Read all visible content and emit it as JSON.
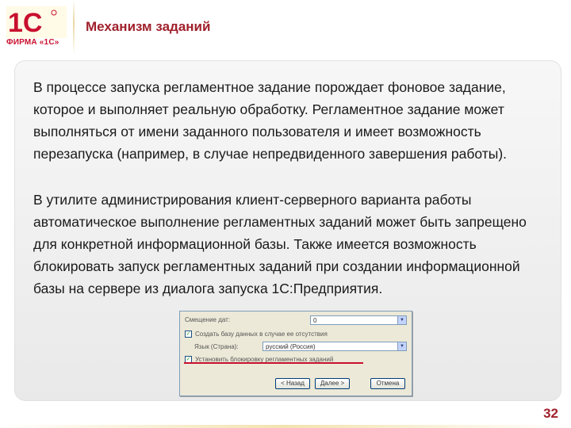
{
  "logo": {
    "mark": "1С",
    "caption": "ФИРМА «1С»"
  },
  "title": "Механизм заданий",
  "paragraphs": [
    "В процессе запуска регламентное задание порождает фоновое задание, которое и выполняет реальную обработку. Регламентное задание может выполняться от имени заданного пользователя и имеет возможность перезапуска (например, в случае непредвиденного завершения работы).",
    "В утилите администрирования клиент-серверного варианта работы автоматическое выполнение регламентных заданий может быть запрещено для конкретной информационной базы. Также имеется возможность блокировать запуск регламентных заданий при создании информационной базы на сервере из диалога запуска 1С:Предприятия."
  ],
  "dialog": {
    "offset_label": "Смещение дат:",
    "offset_value": "0",
    "create_db_label": "Создать базу данных в случае ее отсутствия",
    "language_label": "Язык (Страна):",
    "language_value": "русский (Россия)",
    "block_label": "Установить блокировку регламентных заданий",
    "buttons": [
      "< Назад",
      "Далее >",
      "Отмена"
    ]
  },
  "page_number": "32",
  "colors": {
    "accent": "#a0212c",
    "brand_red": "#c8102e"
  }
}
